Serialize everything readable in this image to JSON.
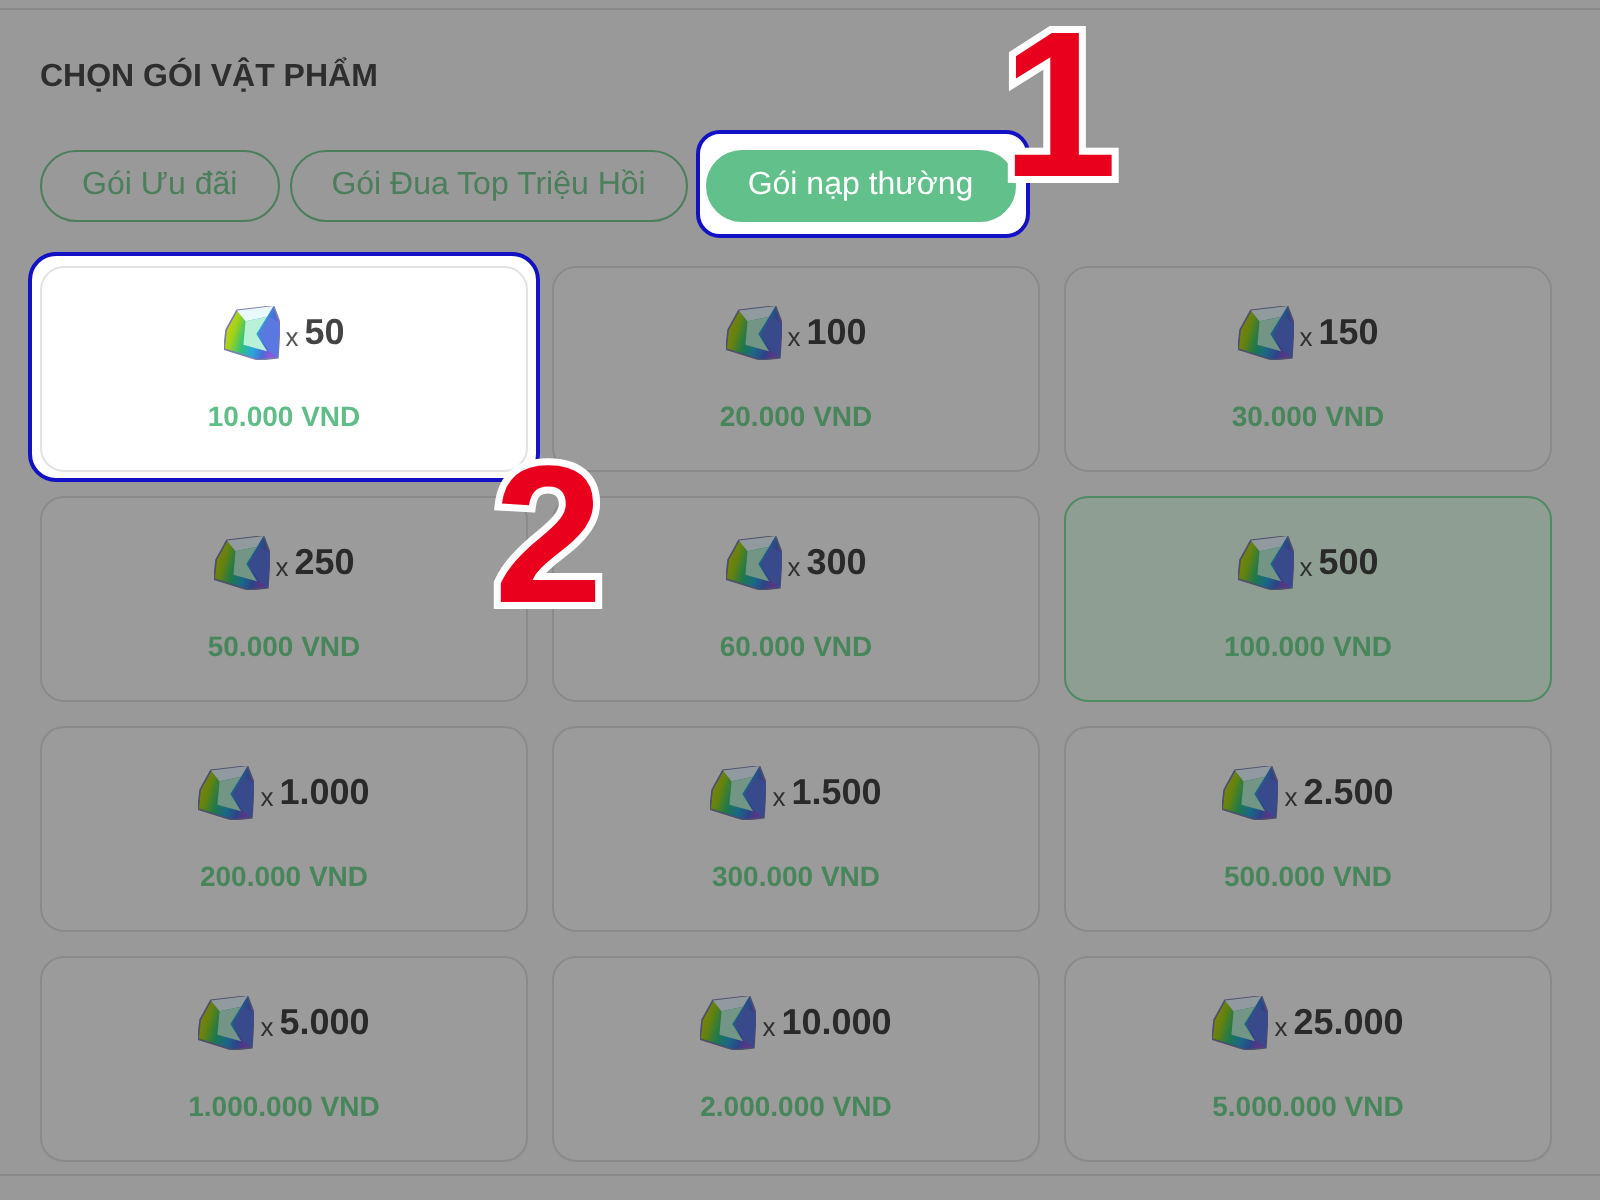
{
  "section": {
    "title": "CHỌN GÓI VẬT PHẨM"
  },
  "tabs": [
    {
      "label": "Gói Ưu đãi",
      "selected": false
    },
    {
      "label": "Gói Đua Top Triệu Hồi",
      "selected": false
    },
    {
      "label": "Gói nạp thường",
      "selected": true,
      "callout": "1"
    }
  ],
  "packages": [
    {
      "multiplier": "x",
      "amount": "50",
      "price": "10.000 VND",
      "selected": false,
      "callout": "2"
    },
    {
      "multiplier": "x",
      "amount": "100",
      "price": "20.000 VND",
      "selected": false
    },
    {
      "multiplier": "x",
      "amount": "150",
      "price": "30.000 VND",
      "selected": false
    },
    {
      "multiplier": "x",
      "amount": "250",
      "price": "50.000 VND",
      "selected": false
    },
    {
      "multiplier": "x",
      "amount": "300",
      "price": "60.000 VND",
      "selected": false
    },
    {
      "multiplier": "x",
      "amount": "500",
      "price": "100.000 VND",
      "selected": true
    },
    {
      "multiplier": "x",
      "amount": "1.000",
      "price": "200.000 VND",
      "selected": false
    },
    {
      "multiplier": "x",
      "amount": "1.500",
      "price": "300.000 VND",
      "selected": false
    },
    {
      "multiplier": "x",
      "amount": "2.500",
      "price": "500.000 VND",
      "selected": false
    },
    {
      "multiplier": "x",
      "amount": "5.000",
      "price": "1.000.000 VND",
      "selected": false
    },
    {
      "multiplier": "x",
      "amount": "10.000",
      "price": "2.000.000 VND",
      "selected": false
    },
    {
      "multiplier": "x",
      "amount": "25.000",
      "price": "5.000.000 VND",
      "selected": false
    }
  ]
}
